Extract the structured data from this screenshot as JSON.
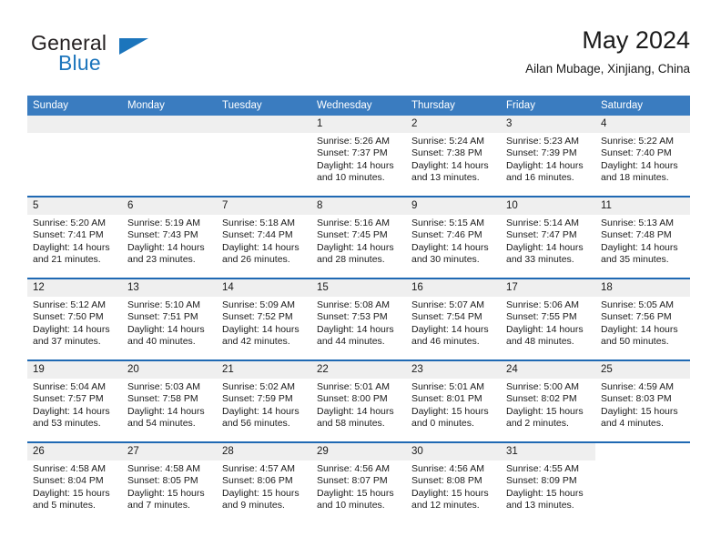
{
  "brand": {
    "line1": "General",
    "line2": "Blue",
    "accent_color": "#1c75bc"
  },
  "header": {
    "title": "May 2024",
    "subtitle": "Ailan Mubage, Xinjiang, China"
  },
  "calendar": {
    "header_bg": "#3a7cc0",
    "row_divider_color": "#1f69b3",
    "daynum_bg": "#efefef",
    "weekdays": [
      "Sunday",
      "Monday",
      "Tuesday",
      "Wednesday",
      "Thursday",
      "Friday",
      "Saturday"
    ],
    "weeks": [
      [
        {
          "day": "",
          "lines": []
        },
        {
          "day": "",
          "lines": []
        },
        {
          "day": "",
          "lines": []
        },
        {
          "day": "1",
          "lines": [
            "Sunrise: 5:26 AM",
            "Sunset: 7:37 PM",
            "Daylight: 14 hours and 10 minutes."
          ]
        },
        {
          "day": "2",
          "lines": [
            "Sunrise: 5:24 AM",
            "Sunset: 7:38 PM",
            "Daylight: 14 hours and 13 minutes."
          ]
        },
        {
          "day": "3",
          "lines": [
            "Sunrise: 5:23 AM",
            "Sunset: 7:39 PM",
            "Daylight: 14 hours and 16 minutes."
          ]
        },
        {
          "day": "4",
          "lines": [
            "Sunrise: 5:22 AM",
            "Sunset: 7:40 PM",
            "Daylight: 14 hours and 18 minutes."
          ]
        }
      ],
      [
        {
          "day": "5",
          "lines": [
            "Sunrise: 5:20 AM",
            "Sunset: 7:41 PM",
            "Daylight: 14 hours and 21 minutes."
          ]
        },
        {
          "day": "6",
          "lines": [
            "Sunrise: 5:19 AM",
            "Sunset: 7:43 PM",
            "Daylight: 14 hours and 23 minutes."
          ]
        },
        {
          "day": "7",
          "lines": [
            "Sunrise: 5:18 AM",
            "Sunset: 7:44 PM",
            "Daylight: 14 hours and 26 minutes."
          ]
        },
        {
          "day": "8",
          "lines": [
            "Sunrise: 5:16 AM",
            "Sunset: 7:45 PM",
            "Daylight: 14 hours and 28 minutes."
          ]
        },
        {
          "day": "9",
          "lines": [
            "Sunrise: 5:15 AM",
            "Sunset: 7:46 PM",
            "Daylight: 14 hours and 30 minutes."
          ]
        },
        {
          "day": "10",
          "lines": [
            "Sunrise: 5:14 AM",
            "Sunset: 7:47 PM",
            "Daylight: 14 hours and 33 minutes."
          ]
        },
        {
          "day": "11",
          "lines": [
            "Sunrise: 5:13 AM",
            "Sunset: 7:48 PM",
            "Daylight: 14 hours and 35 minutes."
          ]
        }
      ],
      [
        {
          "day": "12",
          "lines": [
            "Sunrise: 5:12 AM",
            "Sunset: 7:50 PM",
            "Daylight: 14 hours and 37 minutes."
          ]
        },
        {
          "day": "13",
          "lines": [
            "Sunrise: 5:10 AM",
            "Sunset: 7:51 PM",
            "Daylight: 14 hours and 40 minutes."
          ]
        },
        {
          "day": "14",
          "lines": [
            "Sunrise: 5:09 AM",
            "Sunset: 7:52 PM",
            "Daylight: 14 hours and 42 minutes."
          ]
        },
        {
          "day": "15",
          "lines": [
            "Sunrise: 5:08 AM",
            "Sunset: 7:53 PM",
            "Daylight: 14 hours and 44 minutes."
          ]
        },
        {
          "day": "16",
          "lines": [
            "Sunrise: 5:07 AM",
            "Sunset: 7:54 PM",
            "Daylight: 14 hours and 46 minutes."
          ]
        },
        {
          "day": "17",
          "lines": [
            "Sunrise: 5:06 AM",
            "Sunset: 7:55 PM",
            "Daylight: 14 hours and 48 minutes."
          ]
        },
        {
          "day": "18",
          "lines": [
            "Sunrise: 5:05 AM",
            "Sunset: 7:56 PM",
            "Daylight: 14 hours and 50 minutes."
          ]
        }
      ],
      [
        {
          "day": "19",
          "lines": [
            "Sunrise: 5:04 AM",
            "Sunset: 7:57 PM",
            "Daylight: 14 hours and 53 minutes."
          ]
        },
        {
          "day": "20",
          "lines": [
            "Sunrise: 5:03 AM",
            "Sunset: 7:58 PM",
            "Daylight: 14 hours and 54 minutes."
          ]
        },
        {
          "day": "21",
          "lines": [
            "Sunrise: 5:02 AM",
            "Sunset: 7:59 PM",
            "Daylight: 14 hours and 56 minutes."
          ]
        },
        {
          "day": "22",
          "lines": [
            "Sunrise: 5:01 AM",
            "Sunset: 8:00 PM",
            "Daylight: 14 hours and 58 minutes."
          ]
        },
        {
          "day": "23",
          "lines": [
            "Sunrise: 5:01 AM",
            "Sunset: 8:01 PM",
            "Daylight: 15 hours and 0 minutes."
          ]
        },
        {
          "day": "24",
          "lines": [
            "Sunrise: 5:00 AM",
            "Sunset: 8:02 PM",
            "Daylight: 15 hours and 2 minutes."
          ]
        },
        {
          "day": "25",
          "lines": [
            "Sunrise: 4:59 AM",
            "Sunset: 8:03 PM",
            "Daylight: 15 hours and 4 minutes."
          ]
        }
      ],
      [
        {
          "day": "26",
          "lines": [
            "Sunrise: 4:58 AM",
            "Sunset: 8:04 PM",
            "Daylight: 15 hours and 5 minutes."
          ]
        },
        {
          "day": "27",
          "lines": [
            "Sunrise: 4:58 AM",
            "Sunset: 8:05 PM",
            "Daylight: 15 hours and 7 minutes."
          ]
        },
        {
          "day": "28",
          "lines": [
            "Sunrise: 4:57 AM",
            "Sunset: 8:06 PM",
            "Daylight: 15 hours and 9 minutes."
          ]
        },
        {
          "day": "29",
          "lines": [
            "Sunrise: 4:56 AM",
            "Sunset: 8:07 PM",
            "Daylight: 15 hours and 10 minutes."
          ]
        },
        {
          "day": "30",
          "lines": [
            "Sunrise: 4:56 AM",
            "Sunset: 8:08 PM",
            "Daylight: 15 hours and 12 minutes."
          ]
        },
        {
          "day": "31",
          "lines": [
            "Sunrise: 4:55 AM",
            "Sunset: 8:09 PM",
            "Daylight: 15 hours and 13 minutes."
          ]
        },
        {
          "day": "",
          "lines": [],
          "blank": true
        }
      ]
    ]
  }
}
